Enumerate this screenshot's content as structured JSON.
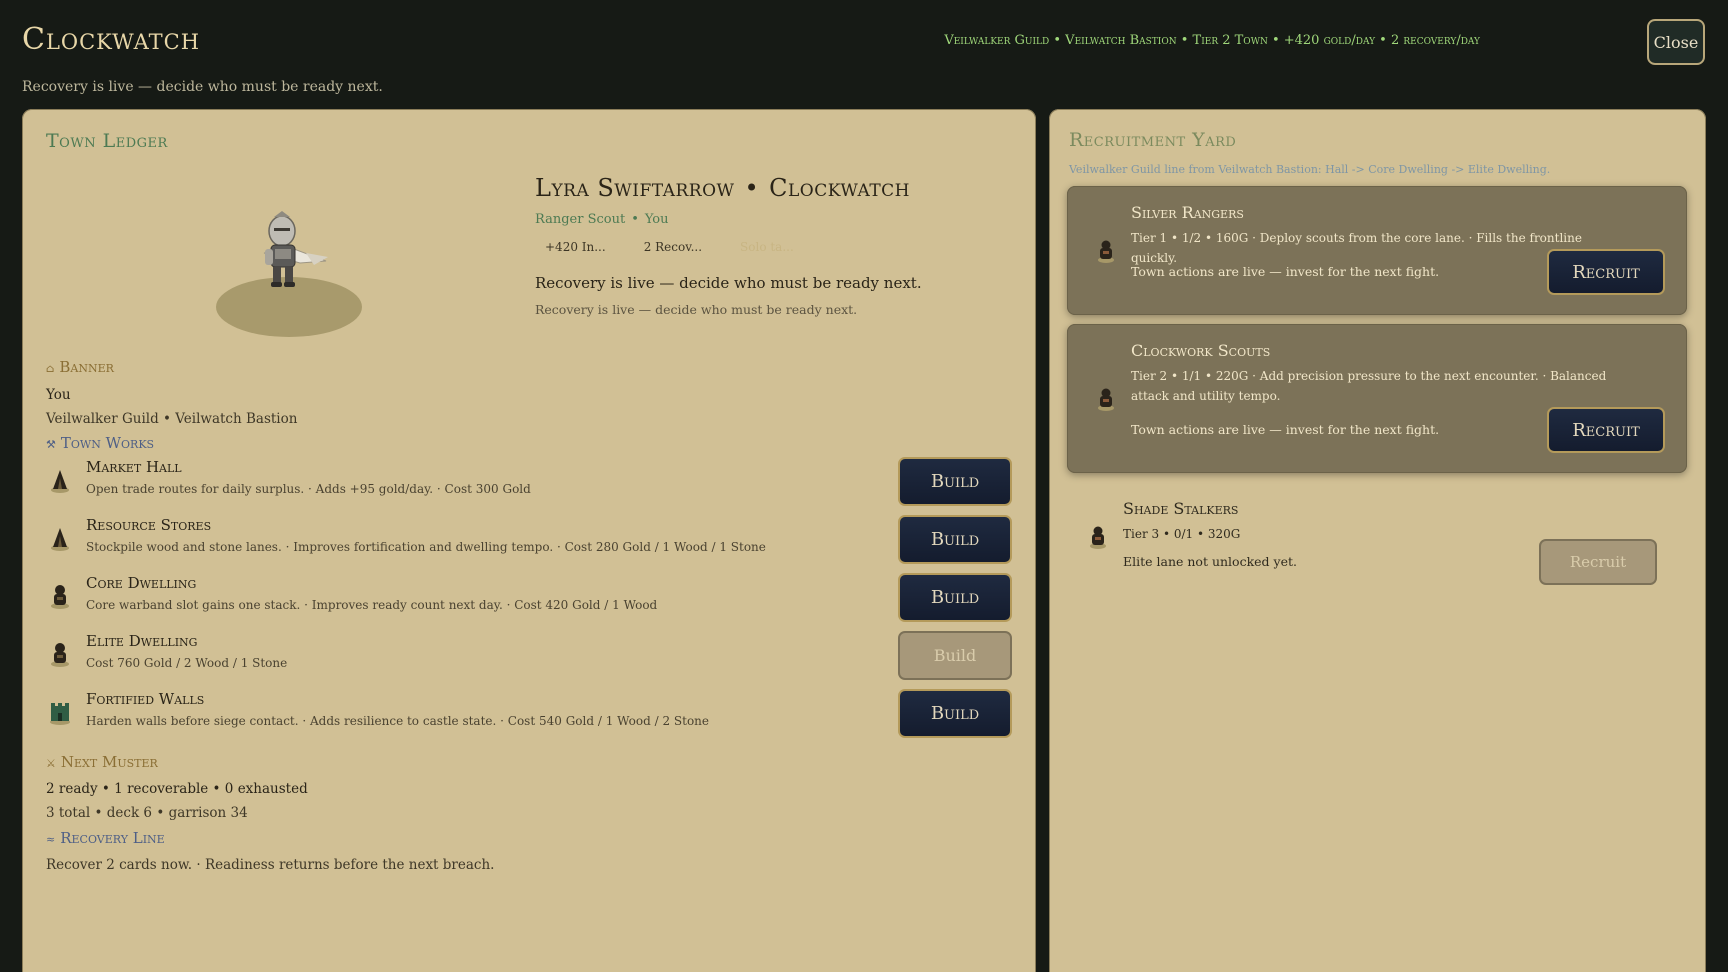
{
  "header": {
    "title": "Clockwatch",
    "subtitle": "Recovery is live — decide who must be ready next.",
    "status": "Veilwalker Guild • Veilwatch Bastion • Tier 2 Town • +420 gold/day • 2 recovery/day",
    "close_label": "Close"
  },
  "ledger": {
    "title": "Town Ledger",
    "hero": {
      "name": "Lyra Swiftarrow",
      "separator": "•",
      "town": "Clockwatch",
      "class": "Ranger Scout",
      "owner": "You",
      "chips": [
        "+420 In...",
        "2 Recov...",
        "Solo ta..."
      ],
      "message": "Recovery is live — decide who must be ready next.",
      "message_detail": "Recovery is live — decide who must be ready next."
    },
    "banner": {
      "heading": "Banner",
      "player": "You",
      "guild_line": "Veilwalker Guild • Veilwatch Bastion"
    },
    "town_works": {
      "heading": "Town Works",
      "items": [
        {
          "name": "Market Hall",
          "desc": "Open trade routes for daily surplus.  ·  Adds +95 gold/day.  ·  Cost 300 Gold",
          "button": "Build",
          "enabled": true,
          "icon": "tent-icon"
        },
        {
          "name": "Resource Stores",
          "desc": "Stockpile wood and stone lanes.  ·  Improves fortification and dwelling tempo.  ·  Cost 280 Gold / 1 Wood / 1 Stone",
          "button": "Build",
          "enabled": true,
          "icon": "tent-icon"
        },
        {
          "name": "Core Dwelling",
          "desc": "Core warband slot gains one stack.  ·  Improves ready count next day.  ·  Cost 420 Gold / 1 Wood",
          "button": "Build",
          "enabled": true,
          "icon": "dwelling-icon"
        },
        {
          "name": "Elite Dwelling",
          "desc": "Cost 760 Gold / 2 Wood / 1 Stone",
          "button": "Build",
          "enabled": false,
          "icon": "dwelling-icon"
        },
        {
          "name": "Fortified Walls",
          "desc": "Harden walls before siege contact.  ·  Adds resilience to castle state.  ·  Cost 540 Gold / 1 Wood / 2 Stone",
          "button": "Build",
          "enabled": true,
          "icon": "castle-icon"
        }
      ]
    },
    "muster": {
      "heading": "Next Muster",
      "line1": "2 ready • 1 recoverable • 0 exhausted",
      "line2": "3 total • deck 6 • garrison 34"
    },
    "recovery": {
      "heading": "Recovery Line",
      "line": "Recover 2 cards now.  ·  Readiness returns before the next breach."
    }
  },
  "yard": {
    "title": "Recruitment Yard",
    "subtitle": "Veilwalker Guild line from Veilwatch Bastion: Hall -> Core Dwelling -> Elite Dwelling.",
    "units": [
      {
        "name": "Silver Rangers",
        "desc": "Tier 1 • 1/2 • 160G  ·  Deploy scouts from the core lane.  ·  Fills the frontline quickly.",
        "note": "Town actions are live — invest for the next fight.",
        "button": "Recruit",
        "enabled": true
      },
      {
        "name": "Clockwork Scouts",
        "desc": "Tier 2 • 1/1 • 220G  ·  Add precision pressure to the next encounter.  ·  Balanced attack and utility tempo.",
        "note": "Town actions are live — invest for the next fight.",
        "button": "Recruit",
        "enabled": true
      },
      {
        "name": "Shade Stalkers",
        "desc": "Tier 3 • 0/1 • 320G",
        "note": "Elite lane not unlocked yet.",
        "button": "Recruit",
        "enabled": false
      }
    ]
  },
  "colors": {
    "background": "#161a15",
    "panel": "#d1c095",
    "accent_green": "#4d7a53",
    "button_navy": "#1f2a40",
    "button_gold_border": "#b49a5a",
    "status_green": "#9fd77a"
  }
}
